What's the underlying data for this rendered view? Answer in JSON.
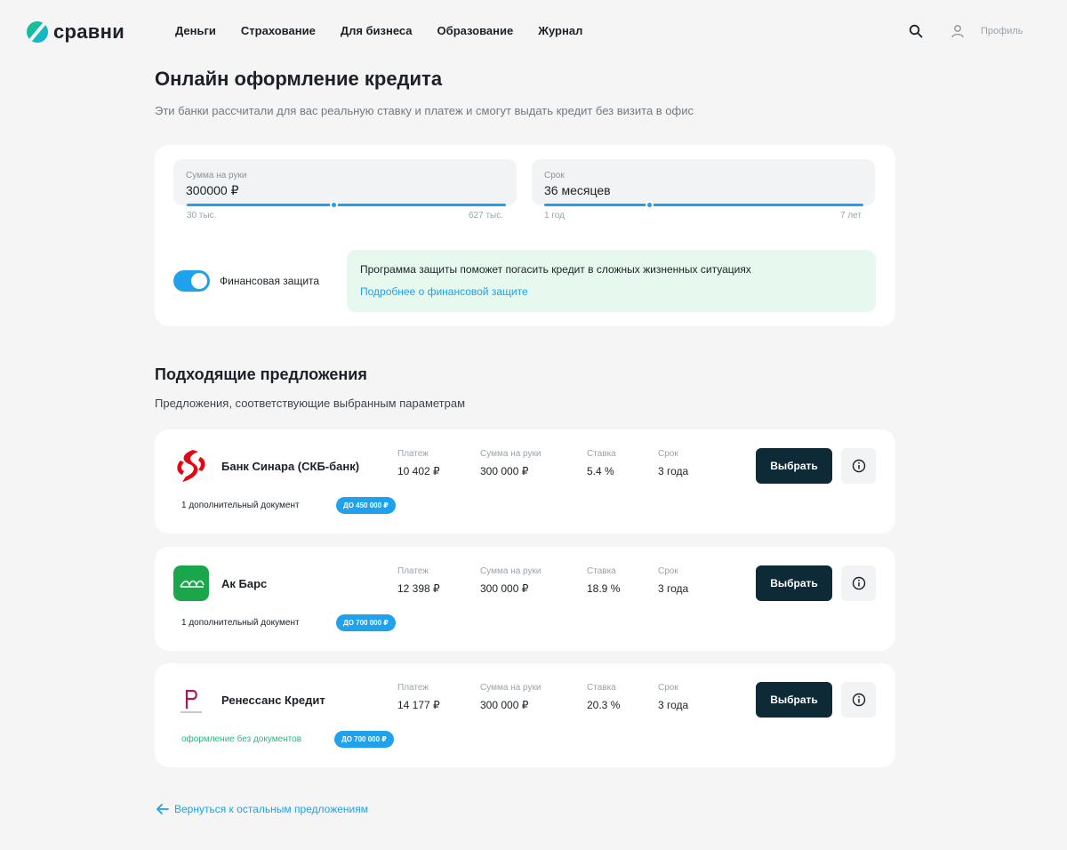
{
  "brand": {
    "name": "сравни"
  },
  "nav": [
    "Деньги",
    "Страхование",
    "Для бизнеса",
    "Образование",
    "Журнал"
  ],
  "profile": {
    "label": "Профиль"
  },
  "page": {
    "title": "Онлайн оформление кредита",
    "subtitle": "Эти банки рассчитали для вас реальную ставку и платеж и смогут выдать кредит без визита в офис"
  },
  "calculator": {
    "amount": {
      "label": "Сумма на руки",
      "value": "300000 ₽",
      "min_label": "30 тыс.",
      "max_label": "627 тыс.",
      "fraction": 0.46
    },
    "term": {
      "label": "Срок",
      "value": "36 месяцев",
      "min_label": "1 год",
      "max_label": "7 лет",
      "fraction": 0.33
    },
    "protection": {
      "toggle_label": "Финансовая защита",
      "enabled": true,
      "info_text": "Программа защиты поможет погасить кредит в сложных жизненных ситуациях",
      "info_link": "Подробнее о финансовой защите"
    }
  },
  "offers_section": {
    "title": "Подходящие предложения",
    "subtitle": "Предложения, соответствующие выбранным параметрам"
  },
  "metric_labels": {
    "payment": "Платеж",
    "amount": "Сумма на руки",
    "rate": "Ставка",
    "term": "Срок"
  },
  "offers": [
    {
      "bank": "Банк Синара (СКБ-банк)",
      "payment": "10 402 ₽",
      "amount": "300 000 ₽",
      "rate": "5.4 %",
      "term": "3 года",
      "doc_note": "1 дополнительный документ",
      "badge": "ДО 450 000 ₽",
      "button": "Выбрать",
      "logo_color": "#e30613"
    },
    {
      "bank": "Ак Барс",
      "payment": "12 398 ₽",
      "amount": "300 000 ₽",
      "rate": "18.9 %",
      "term": "3 года",
      "doc_note": "1 дополнительный документ",
      "badge": "ДО 700 000 ₽",
      "button": "Выбрать",
      "logo_color": "#1aa64a"
    },
    {
      "bank": "Ренессанс Кредит",
      "payment": "14 177 ₽",
      "amount": "300 000 ₽",
      "rate": "20.3 %",
      "term": "3 года",
      "doc_note": "оформление без документов",
      "badge": "ДО 700 000 ₽",
      "button": "Выбрать",
      "logo_color": "#b0145a"
    }
  ],
  "back_link": "Вернуться к остальным предложениям"
}
